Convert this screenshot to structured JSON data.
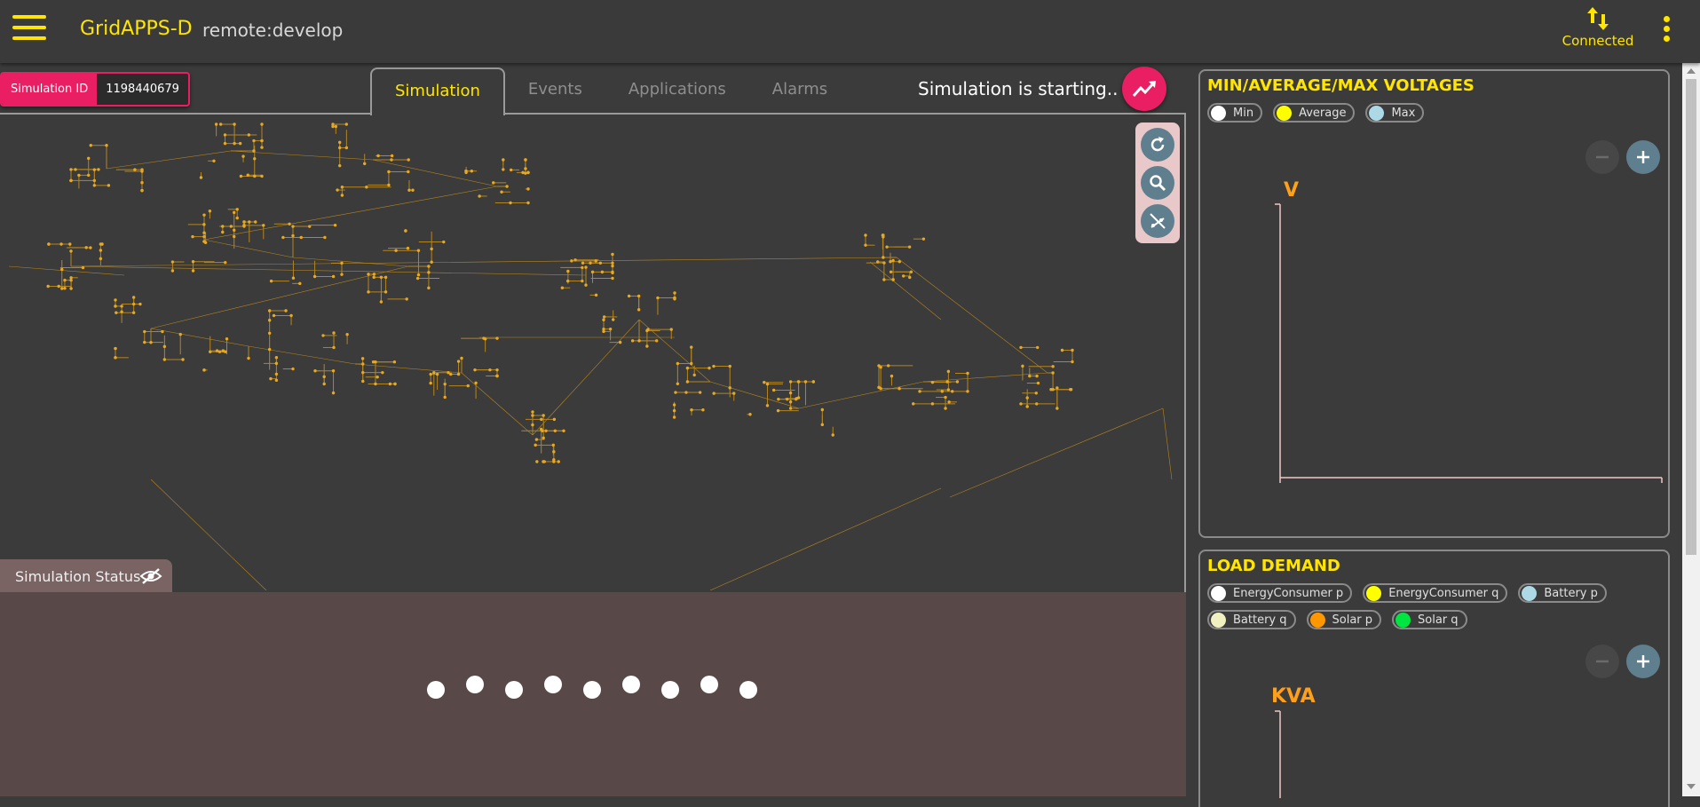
{
  "header": {
    "title": "GridAPPS-D",
    "subtitle": "remote:develop",
    "connection_label": "Connected",
    "icons": {
      "menu": "hamburger-icon",
      "connection": "swap-vertical-icon",
      "more": "more-vert-icon"
    }
  },
  "simulation": {
    "id_label": "Simulation ID",
    "id_value": "1198440679",
    "status_message": "Simulation is starting.."
  },
  "tabs": [
    {
      "label": "Simulation",
      "active": true
    },
    {
      "label": "Events",
      "active": false
    },
    {
      "label": "Applications",
      "active": false
    },
    {
      "label": "Alarms",
      "active": false
    }
  ],
  "map_tools": [
    "refresh-icon",
    "search-icon",
    "toggle-labels-icon"
  ],
  "status_panel": {
    "label": "Simulation Status",
    "icon": "eye-off-icon",
    "loading_dots": 9
  },
  "charts": {
    "voltage": {
      "title": "MIN/AVERAGE/MAX VOLTAGES",
      "y_axis_label": "V",
      "legend": [
        {
          "label": "Min",
          "color": "#ffffff"
        },
        {
          "label": "Average",
          "color": "#ffff00"
        },
        {
          "label": "Max",
          "color": "#add8e6"
        }
      ]
    },
    "load": {
      "title": "LOAD DEMAND",
      "y_axis_label": "KVA",
      "legend": [
        {
          "label": "EnergyConsumer p",
          "color": "#ffffff"
        },
        {
          "label": "EnergyConsumer q",
          "color": "#ffff00"
        },
        {
          "label": "Battery p",
          "color": "#add8e6"
        },
        {
          "label": "Battery q",
          "color": "#f0f0c0"
        },
        {
          "label": "Solar p",
          "color": "#ff9800"
        },
        {
          "label": "Solar q",
          "color": "#00e640"
        }
      ]
    }
  },
  "colors": {
    "accent": "#ffe500",
    "brand_pink": "#e91e63",
    "map_lines": "#e0a020",
    "axis_label": "#ff9f1a"
  }
}
